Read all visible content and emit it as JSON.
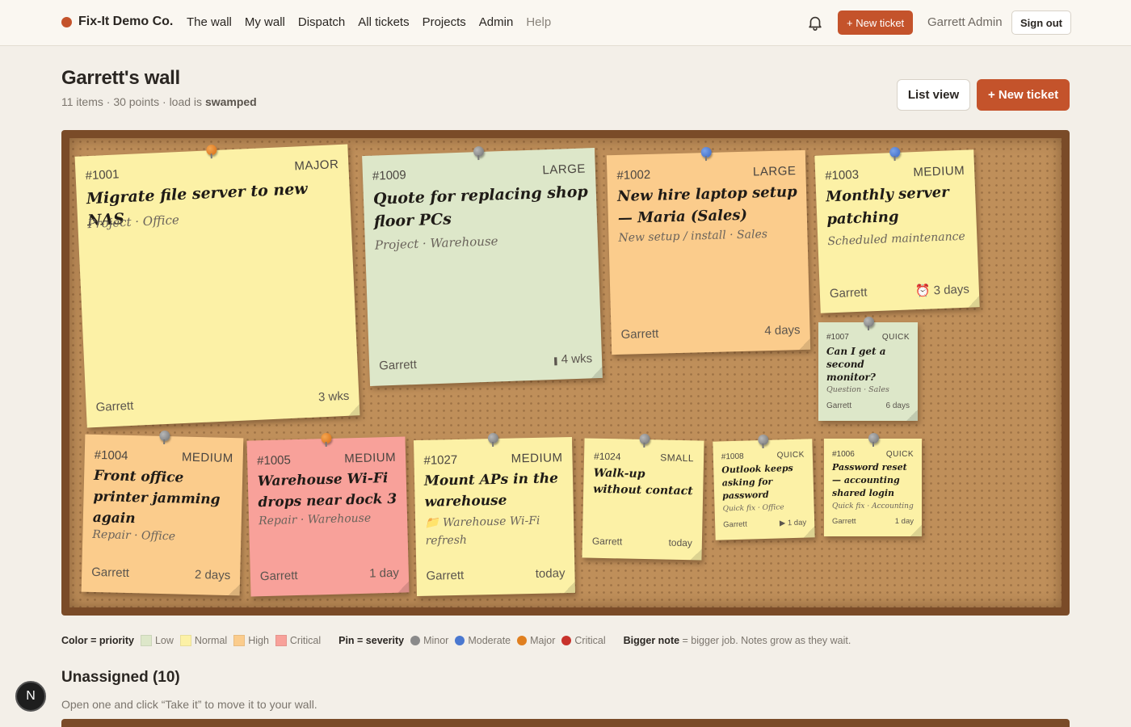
{
  "nav": {
    "brand": "Fix-It Demo Co.",
    "links": [
      "The wall",
      "My wall",
      "Dispatch",
      "All tickets",
      "Projects",
      "Admin"
    ],
    "help": "Help",
    "new_ticket": "+ New ticket",
    "user": "Garrett Admin",
    "sign_out": "Sign out",
    "bell_icon": "bell-icon"
  },
  "header": {
    "title": "Garrett's wall",
    "sub_prefix": "11 items · 30 points · load is ",
    "sub_load": "swamped",
    "list_view": "List view",
    "new_ticket": "+ New ticket"
  },
  "notes": [
    {
      "id": "#1001",
      "size": "MAJOR",
      "title": "Migrate file server to new NAS",
      "category": "Project · Office",
      "owner": "Garrett",
      "age": "3 wks",
      "color": "normal",
      "pin": "major"
    },
    {
      "id": "#1009",
      "size": "LARGE",
      "title": "Quote for replacing shop floor PCs",
      "category": "Project · Warehouse",
      "owner": "Garrett",
      "age": "4 wks",
      "color": "low",
      "pin": "minor"
    },
    {
      "id": "#1002",
      "size": "LARGE",
      "title": "New hire laptop setup — Maria (Sales)",
      "category": "New setup / install · Sales",
      "owner": "Garrett",
      "age": "4 days",
      "color": "high",
      "pin": "moderate"
    },
    {
      "id": "#1003",
      "size": "MEDIUM",
      "title": "Monthly server patching",
      "category": "Scheduled maintenance",
      "owner": "Garrett",
      "age": "3 days",
      "color": "normal",
      "pin": "moderate"
    },
    {
      "id": "#1007",
      "size": "QUICK",
      "title": "Can I get a second monitor?",
      "category": "Question · Sales",
      "owner": "Garrett",
      "age": "6 days",
      "color": "low",
      "pin": "minor"
    },
    {
      "id": "#1004",
      "size": "MEDIUM",
      "title": "Front office printer jamming again",
      "category": "Repair · Office",
      "owner": "Garrett",
      "age": "2 days",
      "color": "high",
      "pin": "minor"
    },
    {
      "id": "#1005",
      "size": "MEDIUM",
      "title": "Warehouse Wi-Fi drops near dock 3",
      "category": "Repair · Warehouse",
      "owner": "Garrett",
      "age": "1 day",
      "color": "critical",
      "pin": "major"
    },
    {
      "id": "#1027",
      "size": "MEDIUM",
      "title": "Mount APs in the warehouse",
      "category": "📁 Warehouse Wi-Fi refresh",
      "owner": "Garrett",
      "age": "today",
      "color": "normal",
      "pin": "minor"
    },
    {
      "id": "#1024",
      "size": "SMALL",
      "title": "Walk-up without contact",
      "category": "",
      "owner": "Garrett",
      "age": "today",
      "color": "normal",
      "pin": "minor"
    },
    {
      "id": "#1008",
      "size": "QUICK",
      "title": "Outlook keeps asking for password",
      "category": "Quick fix · Office",
      "owner": "Garrett",
      "age": "▶ 1 day",
      "color": "normal",
      "pin": "minor"
    },
    {
      "id": "#1006",
      "size": "QUICK",
      "title": "Password reset — accounting shared login",
      "category": "Quick fix · Accounting",
      "owner": "Garrett",
      "age": "1 day",
      "color": "normal",
      "pin": "minor"
    }
  ],
  "legend": {
    "color_label": "Color = priority",
    "colors": [
      {
        "label": "Low",
        "hex": "#dde7c9"
      },
      {
        "label": "Normal",
        "hex": "#fcf1a6"
      },
      {
        "label": "High",
        "hex": "#fbcc8c"
      },
      {
        "label": "Critical",
        "hex": "#f8a19a"
      }
    ],
    "pin_label": "Pin = severity",
    "pins": [
      {
        "label": "Minor",
        "hex": "#8a8a8a"
      },
      {
        "label": "Moderate",
        "hex": "#4a78d0"
      },
      {
        "label": "Major",
        "hex": "#e07f1f"
      },
      {
        "label": "Critical",
        "hex": "#c8322b"
      }
    ],
    "size_label": "Bigger note",
    "size_text": " = bigger job. Notes grow as they wait."
  },
  "unassigned": {
    "title": "Unassigned (10)",
    "sub": "Open one and click “Take it” to move it to your wall."
  },
  "fab": "N",
  "colors": {
    "accent": "#c4532b",
    "board": "#7a4b28",
    "cork": "#bf8f5a"
  }
}
